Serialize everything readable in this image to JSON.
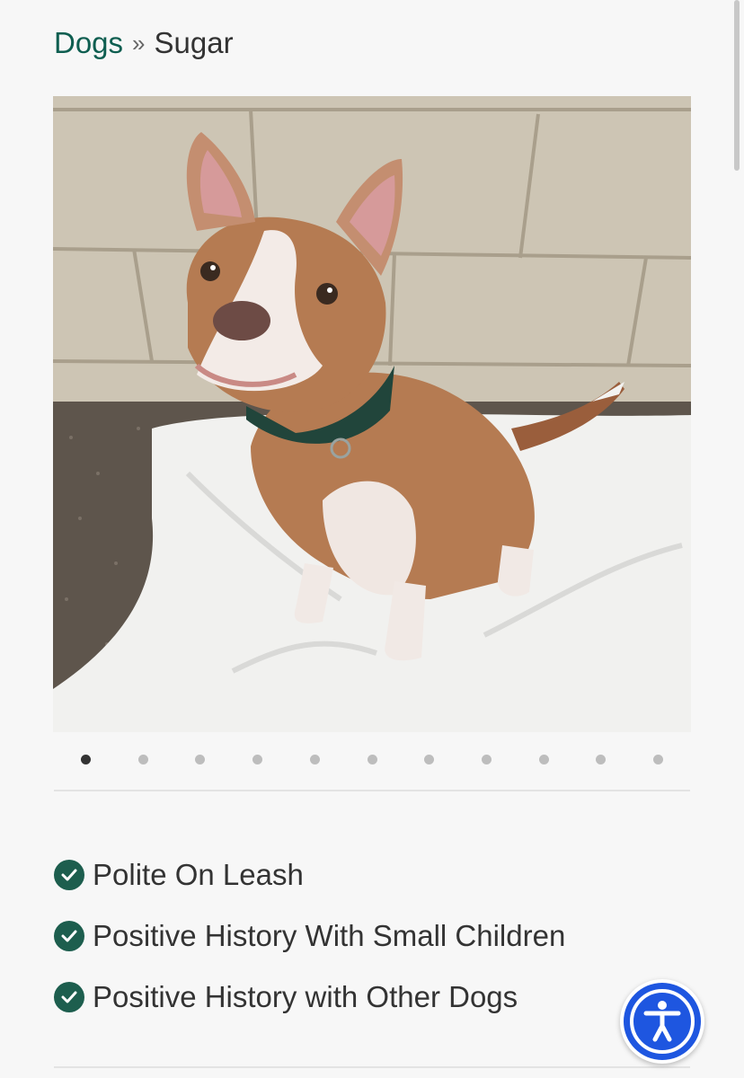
{
  "breadcrumb": {
    "parent": "Dogs",
    "separator": "»",
    "current": "Sugar"
  },
  "gallery": {
    "slide_count": 11,
    "active_slide": 1
  },
  "traits": [
    {
      "label": "Polite On Leash"
    },
    {
      "label": "Positive History With Small Children"
    },
    {
      "label": "Positive History with Other Dogs"
    }
  ],
  "colors": {
    "brand_green": "#0e5e50",
    "check_green": "#1d5e4e",
    "accessibility_blue": "#1e56e0"
  },
  "icons": {
    "trait": "check-circle-icon",
    "accessibility": "accessibility-person-icon"
  }
}
